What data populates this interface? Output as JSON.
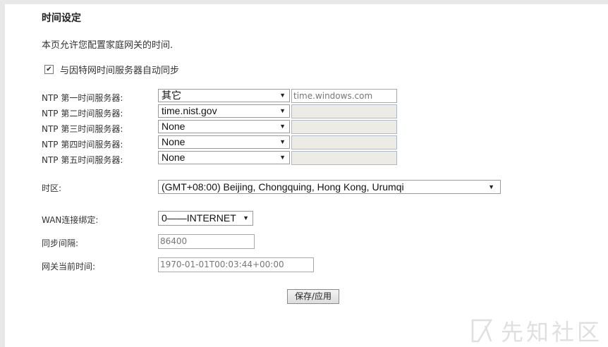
{
  "title": "时间设定",
  "description": "本页允许您配置家庭网关的时间.",
  "auto_sync": {
    "label": "与因特网时间服务器自动同步",
    "checked": true
  },
  "ntp_servers": [
    {
      "label": "NTP 第一时间服务器:",
      "selected": "其它",
      "custom_value": "time.windows.com"
    },
    {
      "label": "NTP 第二时间服务器:",
      "selected": "time.nist.gov",
      "custom_value": ""
    },
    {
      "label": "NTP 第三时间服务器:",
      "selected": "None",
      "custom_value": ""
    },
    {
      "label": "NTP 第四时间服务器:",
      "selected": "None",
      "custom_value": ""
    },
    {
      "label": "NTP 第五时间服务器:",
      "selected": "None",
      "custom_value": ""
    }
  ],
  "timezone": {
    "label": "时区:",
    "selected": "(GMT+08:00) Beijing, Chongquing, Hong Kong, Urumqi"
  },
  "wan_binding": {
    "label": "WAN连接绑定:",
    "selected": "0——INTERNET"
  },
  "sync_interval": {
    "label": "同步间隔:",
    "value": "86400"
  },
  "gateway_time": {
    "label": "网关当前时间:",
    "value": "1970-01-01T00:03:44+00:00"
  },
  "save_button": "保存/应用",
  "icons": {
    "dropdown": "chevron-down-icon",
    "checkbox": "check-icon"
  },
  "watermark": "先知社区"
}
